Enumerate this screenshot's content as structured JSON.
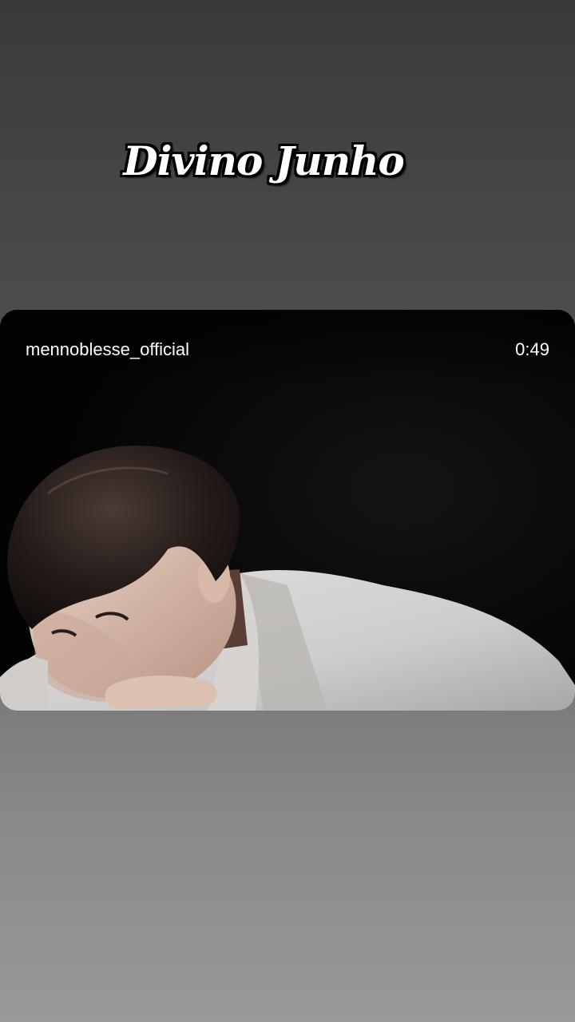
{
  "story": {
    "title": "Divino Junho"
  },
  "video": {
    "username": "mennoblesse_official",
    "duration": "0:49"
  }
}
